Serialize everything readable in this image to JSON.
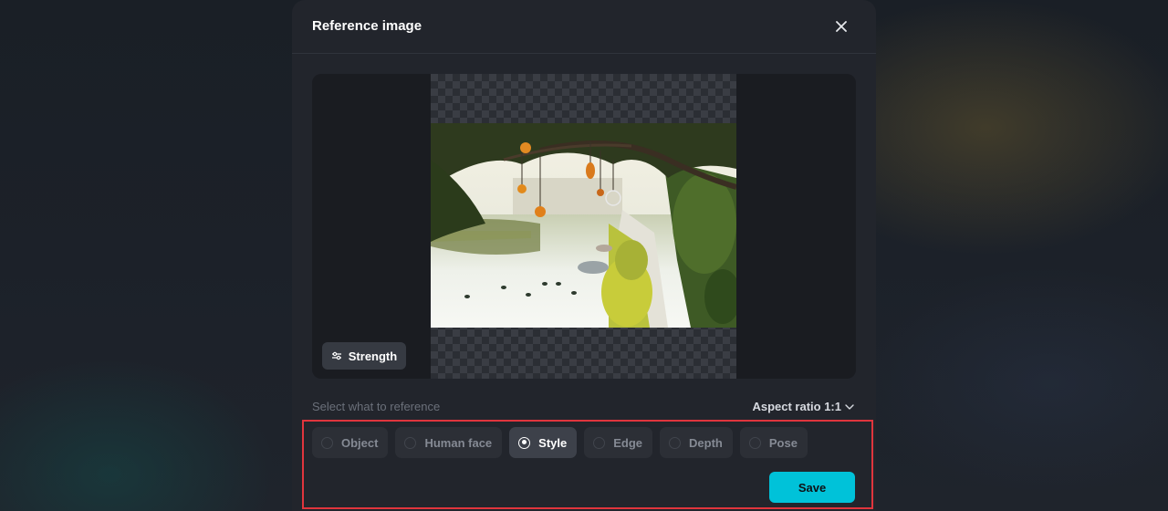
{
  "modal": {
    "title": "Reference image",
    "close_icon": "close-icon"
  },
  "preview": {
    "strength_label": "Strength",
    "strength_icon": "sliders-icon",
    "image_alt": "Canal with hanging lanterns under a tree, ducks on the water"
  },
  "reference": {
    "prompt": "Select what to reference",
    "aspect_label": "Aspect ratio 1:1",
    "aspect_icon": "chevron-down-icon",
    "options": [
      {
        "label": "Object",
        "selected": false
      },
      {
        "label": "Human face",
        "selected": false
      },
      {
        "label": "Style",
        "selected": true
      },
      {
        "label": "Edge",
        "selected": false
      },
      {
        "label": "Depth",
        "selected": false
      },
      {
        "label": "Pose",
        "selected": false
      }
    ]
  },
  "actions": {
    "save_label": "Save"
  },
  "colors": {
    "accent": "#00c2d9",
    "highlight": "#e0353d",
    "modal_bg": "#22252c"
  }
}
